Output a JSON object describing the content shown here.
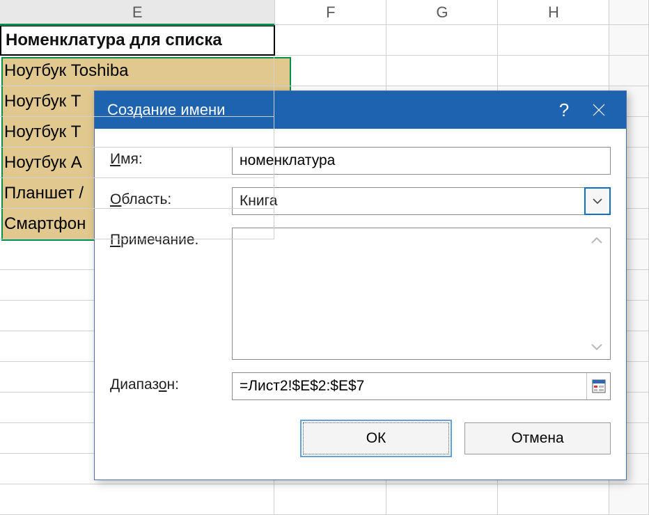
{
  "columns": {
    "E": "E",
    "F": "F",
    "G": "G",
    "H": "H"
  },
  "sheet": {
    "header": "Номенклатура для списка",
    "rows": [
      "Ноутбук Toshiba",
      "Ноутбук T",
      "Ноутбук T",
      "Ноутбук A",
      "Планшет /",
      "Смартфон"
    ]
  },
  "dialog": {
    "title": "Создание имени",
    "labels": {
      "name_pre": "И",
      "name_post": "мя:",
      "scope_pre": "О",
      "scope_post": "бласть:",
      "note_pre": "П",
      "note_post": "римечание.",
      "range_pre": "Диапаз",
      "range_u": "о",
      "range_post": "н:"
    },
    "name_value": "номенклатура",
    "scope_value": "Книга",
    "note_value": "",
    "range_value": "=Лист2!$E$2:$E$7",
    "buttons": {
      "ok": "ОК",
      "cancel": "Отмена"
    }
  }
}
